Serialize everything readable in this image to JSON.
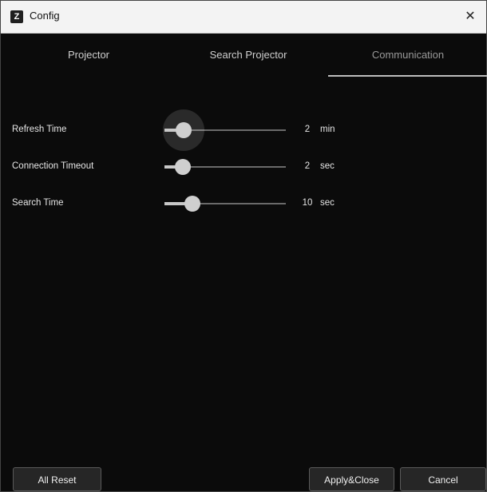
{
  "window": {
    "title": "Config",
    "app_icon": "Z",
    "close_symbol": "✕"
  },
  "tabs": [
    {
      "label": "Projector",
      "active": false
    },
    {
      "label": "Search Projector",
      "active": false
    },
    {
      "label": "Communication",
      "active": true
    }
  ],
  "settings": [
    {
      "label": "Refresh Time",
      "value": "2",
      "unit": "min",
      "slider_fraction": 0.16,
      "focused": true
    },
    {
      "label": "Connection Timeout",
      "value": "2",
      "unit": "sec",
      "slider_fraction": 0.15,
      "focused": false
    },
    {
      "label": "Search Time",
      "value": "10",
      "unit": "sec",
      "slider_fraction": 0.23,
      "focused": false
    }
  ],
  "buttons": {
    "reset": "All Reset",
    "apply": "Apply&Close",
    "cancel": "Cancel"
  },
  "colors": {
    "background": "#0b0b0b",
    "titlebar": "#f3f3f3",
    "slider_active": "#c8c8c8",
    "slider_track": "#6a6a6a"
  }
}
